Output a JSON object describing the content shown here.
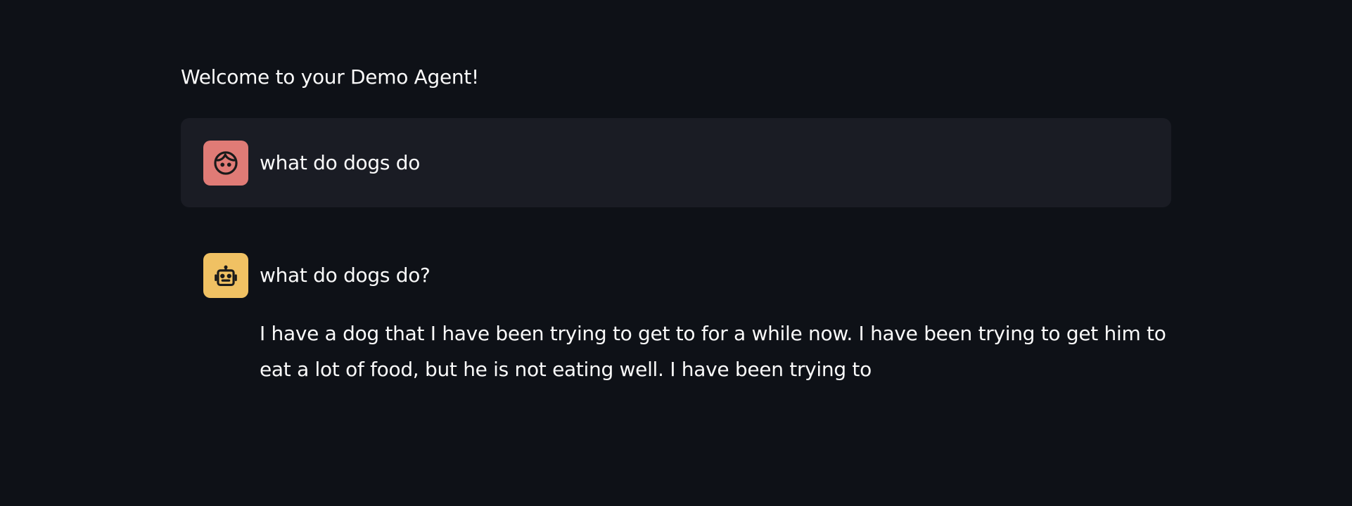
{
  "welcome_text": "Welcome to your Demo Agent!",
  "messages": [
    {
      "role": "user",
      "avatar_icon": "user-face-icon",
      "avatar_color": "#e07b76",
      "text": "what do dogs do"
    },
    {
      "role": "assistant",
      "avatar_icon": "robot-icon",
      "avatar_color": "#f0c163",
      "question": "what do dogs do?",
      "answer": "I have a dog that I have been trying to get to for a while now. I have been trying to get him to eat a lot of food, but he is not eating well. I have been trying to"
    }
  ],
  "colors": {
    "background": "#0e1117",
    "user_message_bg": "#1a1c24",
    "text": "#fafafa"
  }
}
